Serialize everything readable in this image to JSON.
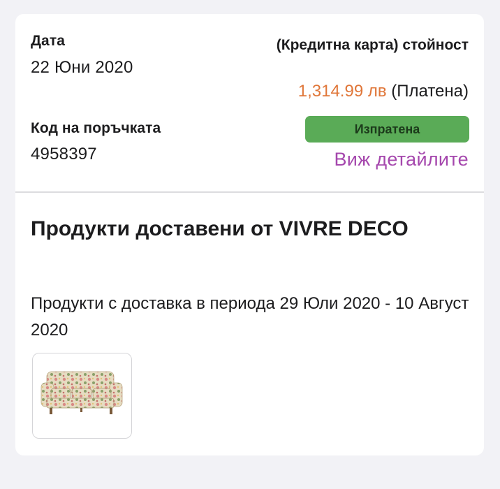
{
  "order": {
    "date_label": "Дата",
    "date_value": "22 Юни 2020",
    "code_label": "Код на поръчката",
    "code_value": "4958397",
    "payment_label": "(Кредитна карта) стойност",
    "amount": "1,314.99 лв",
    "payment_status": "(Платена)",
    "shipping_status": "Изпратена",
    "details_link": "Виж детайлите"
  },
  "delivery": {
    "title": "Продукти доставени от VIVRE DECO",
    "note": "Продукти с доставка в периода 29 Юли 2020 - 10 Август 2020"
  },
  "products": [
    {
      "icon": "floral-sofa-thumbnail"
    }
  ],
  "colors": {
    "amount": "#e0773a",
    "status_badge": "#5aab57",
    "link": "#a547ad"
  }
}
